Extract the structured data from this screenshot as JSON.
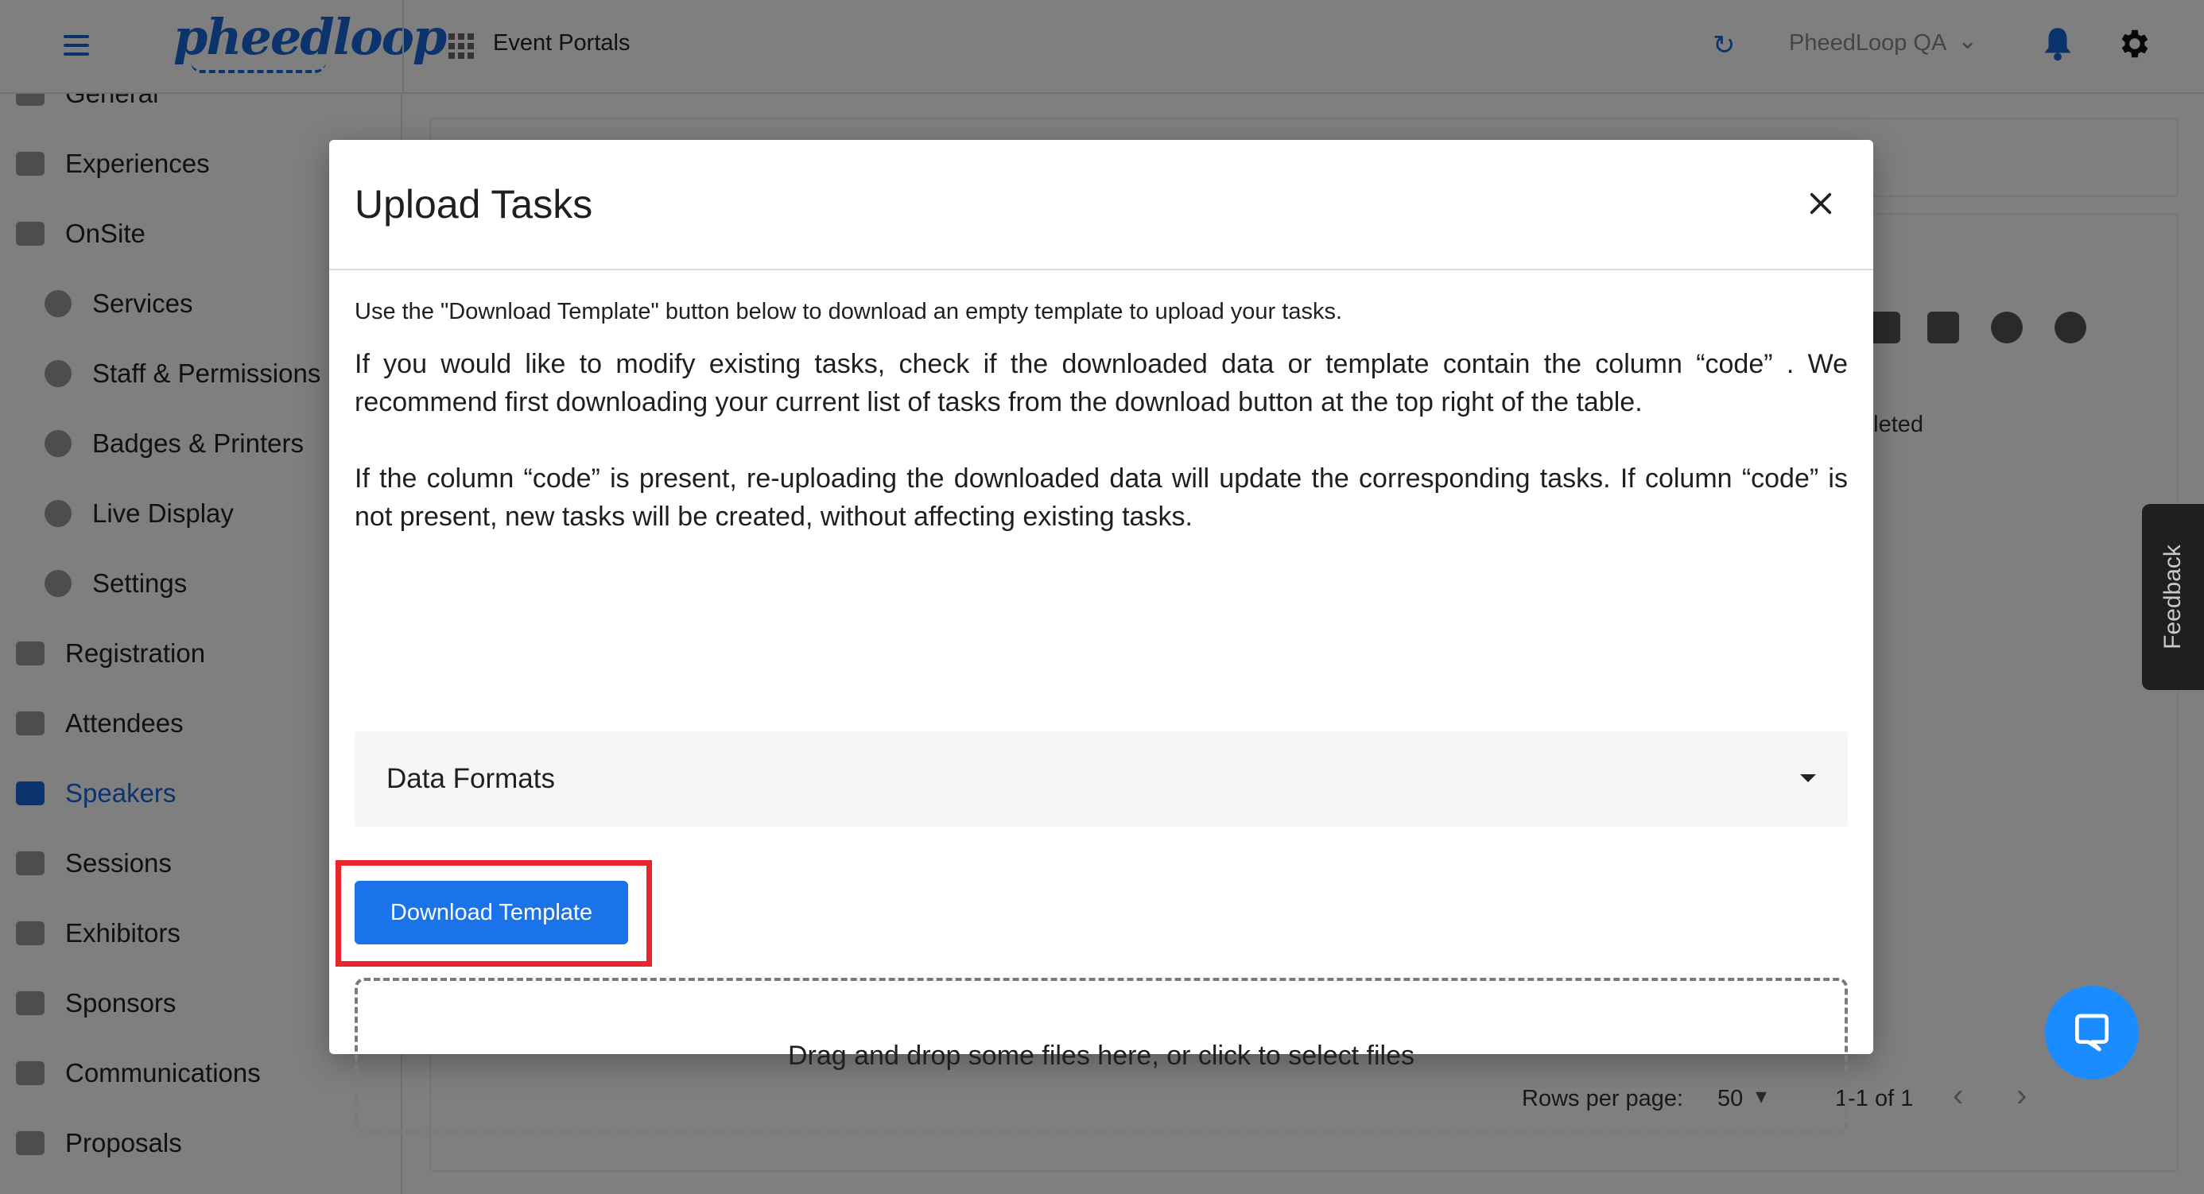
{
  "topbar": {
    "logo_text": "pheedloop",
    "portal_label": "Event Portals",
    "org_name": "PheedLoop QA",
    "icons": [
      "menu-icon",
      "apps-icon",
      "refresh-icon",
      "chevron-down-icon",
      "bell-icon",
      "gear-icon"
    ]
  },
  "sidebar": {
    "items": [
      {
        "label": "General",
        "icon": "grid-icon",
        "level": 0
      },
      {
        "label": "Experiences",
        "icon": "person-icon",
        "level": 0
      },
      {
        "label": "OnSite",
        "icon": "printer-icon",
        "level": 0
      },
      {
        "label": "Services",
        "icon": "services-icon",
        "level": 1
      },
      {
        "label": "Staff & Permissions",
        "icon": "people-icon",
        "level": 1
      },
      {
        "label": "Badges & Printers",
        "icon": "printer-icon",
        "level": 1
      },
      {
        "label": "Live Display",
        "icon": "monitor-icon",
        "level": 1
      },
      {
        "label": "Settings",
        "icon": "gear-icon",
        "level": 1
      },
      {
        "label": "Registration",
        "icon": "cart-icon",
        "level": 0
      },
      {
        "label": "Attendees",
        "icon": "people-icon",
        "level": 0
      },
      {
        "label": "Speakers",
        "icon": "presenter-icon",
        "level": 0,
        "active": true
      },
      {
        "label": "Sessions",
        "icon": "laptop-icon",
        "level": 0
      },
      {
        "label": "Exhibitors",
        "icon": "store-icon",
        "level": 0
      },
      {
        "label": "Sponsors",
        "icon": "badge-icon",
        "level": 0
      },
      {
        "label": "Communications",
        "icon": "mail-icon",
        "level": 0
      },
      {
        "label": "Proposals",
        "icon": "document-icon",
        "level": 0
      }
    ]
  },
  "background": {
    "completed_partial": "pleted",
    "rows_per_page_label": "Rows per page:",
    "rows_per_page_value": "50",
    "page_range": "1-1 of 1",
    "toolbar_icons": [
      "columns-icon",
      "filter-icon",
      "cloud-download-icon",
      "cloud-upload-icon"
    ]
  },
  "feedback": {
    "label": "Feedback"
  },
  "modal": {
    "title": "Upload Tasks",
    "intro": "Use the \"Download Template\" button below to download an empty template to upload your tasks.",
    "paragraph1": "If you would like to modify existing tasks, check if the downloaded data or template contain the column “code” . We recommend first downloading your current list of tasks from the download button at the top right of the table.",
    "paragraph2": "If the column “code” is present, re-uploading the downloaded data will update the corresponding tasks. If column “code” is not present, new tasks will be created, without affecting existing tasks.",
    "data_formats_label": "Data Formats",
    "download_button_label": "Download Template",
    "dropzone_text": "Drag and drop some files here, or click to select files"
  },
  "colors": {
    "brand": "#1b66d8",
    "button": "#1a73e8",
    "highlight": "#e8262d",
    "chat": "#1b8cff"
  }
}
